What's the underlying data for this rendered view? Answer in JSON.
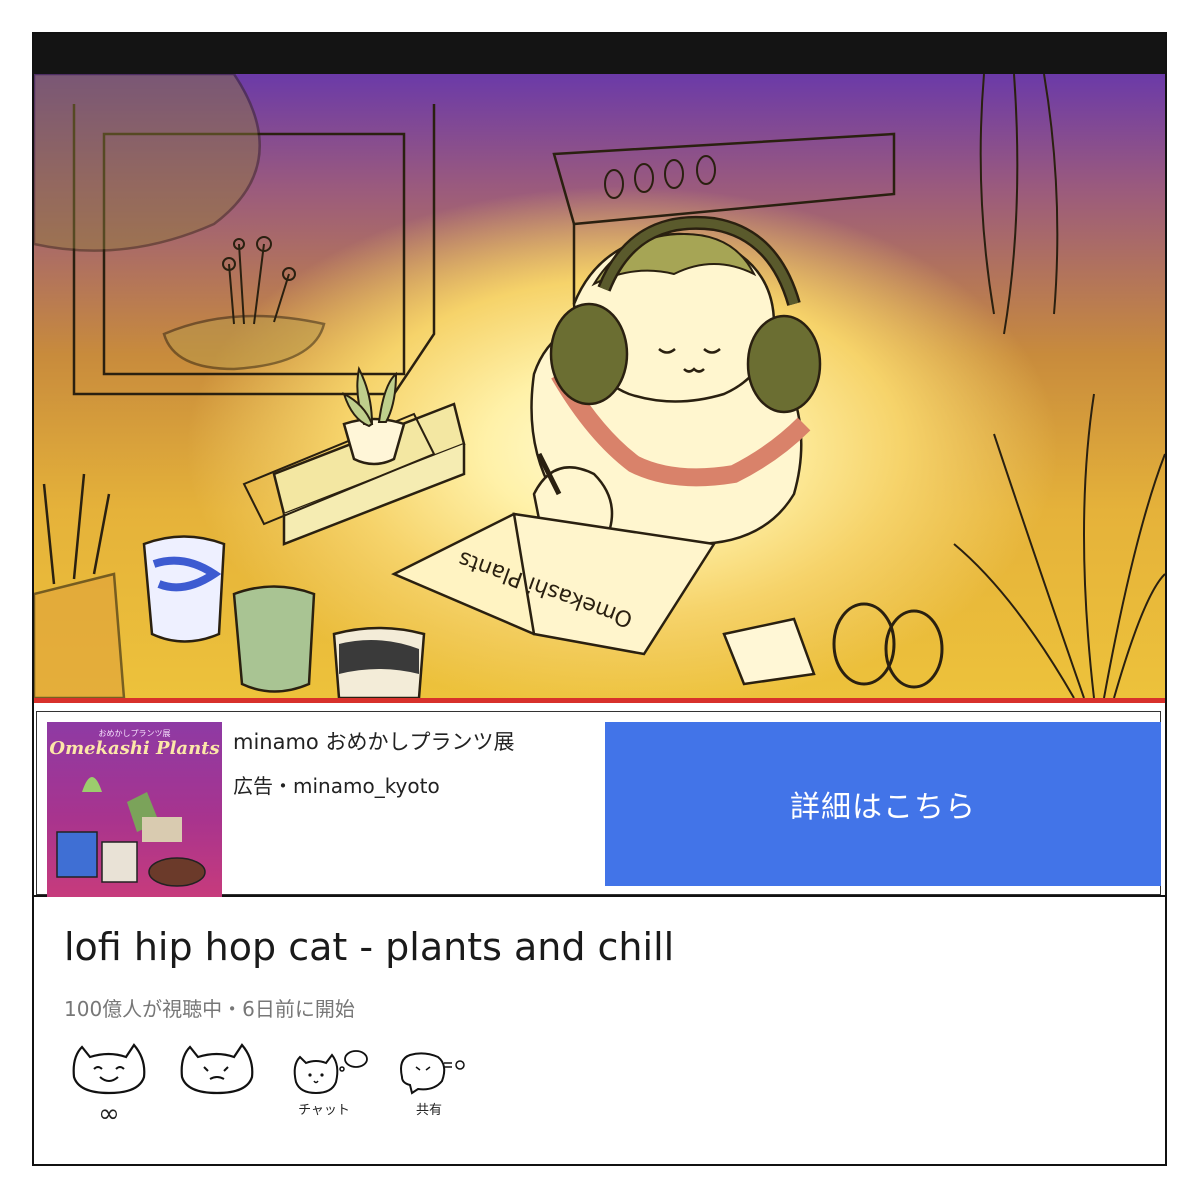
{
  "ad": {
    "thumbnail": {
      "subtitle": "おめかしプランツ展",
      "title": "Omekashi Plants"
    },
    "title": "minamo おめかしプランツ展",
    "sponsor": "広告・minamo_kyoto",
    "cta_label": "詳細はこちら"
  },
  "video": {
    "title": "lofi hip hop cat - plants and chill",
    "meta": "100億人が視聴中・6日前に開始",
    "notebook_text": "Omekashi Plants"
  },
  "actions": [
    {
      "label": "∞",
      "icon": "cat-face-like-icon"
    },
    {
      "label": "",
      "icon": "cat-face-dislike-icon"
    },
    {
      "label": "チャット",
      "icon": "cat-chat-icon"
    },
    {
      "label": "共有",
      "icon": "cat-share-icon"
    }
  ],
  "colors": {
    "progress": "#d8312b",
    "cta_background": "#4274e8",
    "topbar": "#141414"
  }
}
